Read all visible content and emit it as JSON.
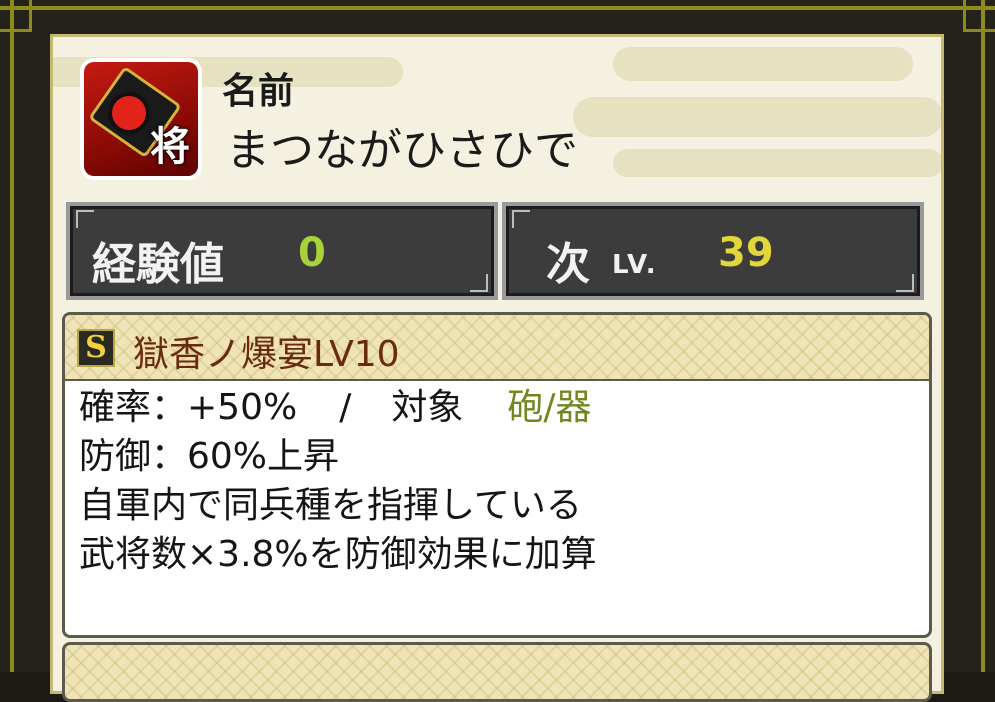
{
  "header": {
    "avatar_glyph": "将",
    "name_label": "名前",
    "name_value": "まつながひさひで"
  },
  "stats": {
    "exp_label": "経験値",
    "exp_value": "0",
    "next_label": "次",
    "next_lv": "LV.",
    "next_value": "39"
  },
  "skill": {
    "rank": "S",
    "name": "獄香ノ爆宴LV10",
    "rate_label": "確率：+50%",
    "separator": "/",
    "target_label": "対象",
    "target_value": "砲/器",
    "line2": "防御：60%上昇",
    "line3": "自軍内で同兵種を指揮している",
    "line4": "武将数×3.8%を防御効果に加算"
  },
  "colors": {
    "exp_value": "#a8d43a",
    "next_value": "#e2d63a",
    "target_value": "#72881e",
    "skill_name": "#6a2a0e",
    "frame_gold": "#8f8a1c"
  }
}
